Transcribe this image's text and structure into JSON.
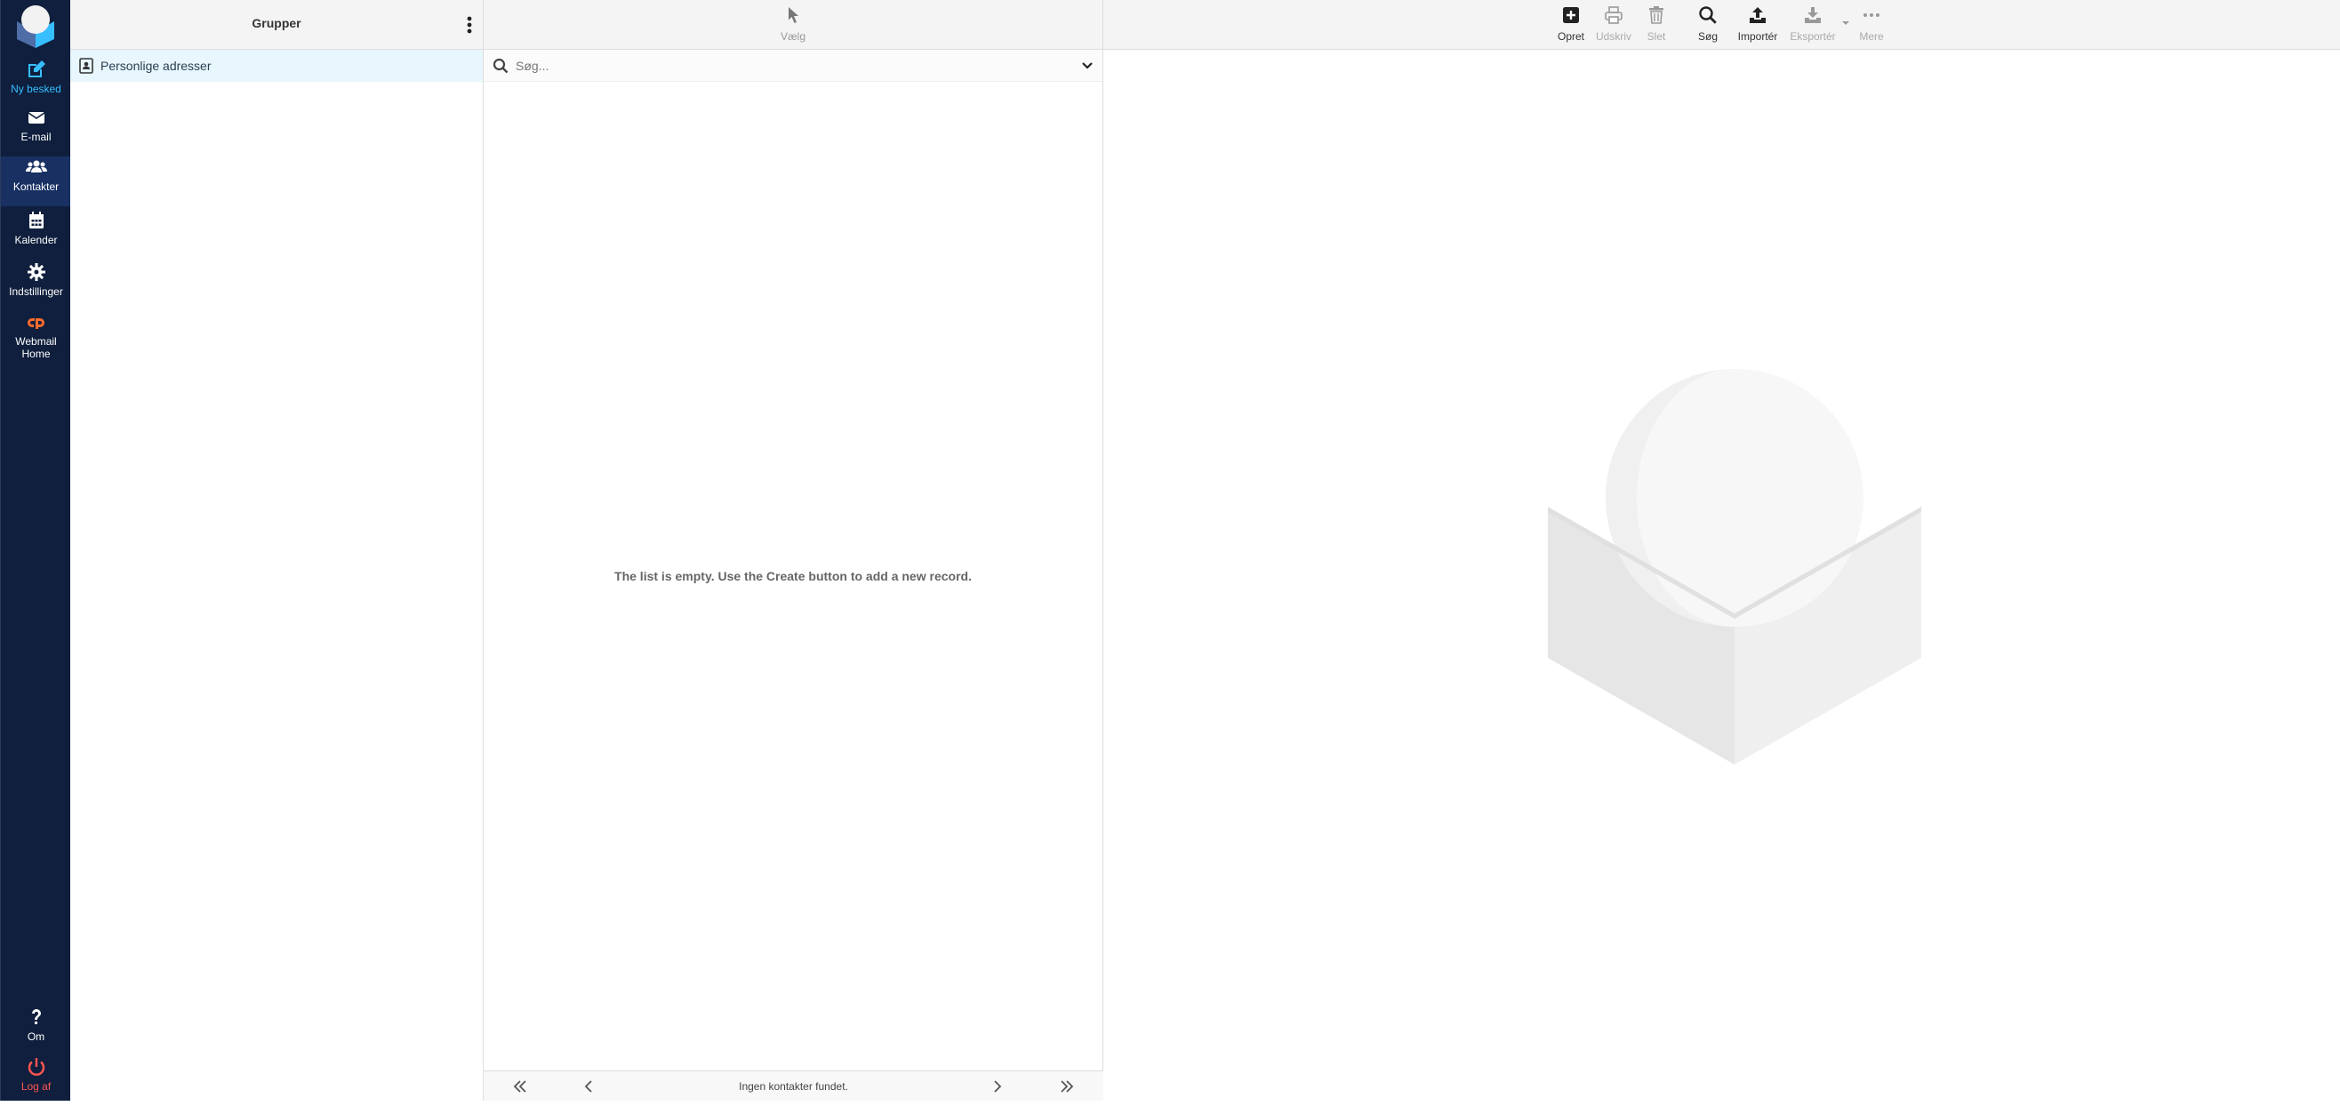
{
  "nav": {
    "compose": "Ny besked",
    "mail": "E-mail",
    "contacts": "Kontakter",
    "calendar": "Kalender",
    "settings": "Indstillinger",
    "webmail_home_1": "Webmail",
    "webmail_home_2": "Home",
    "about": "Om",
    "logout": "Log af"
  },
  "groups": {
    "title": "Grupper",
    "items": [
      {
        "label": "Personlige adresser"
      }
    ]
  },
  "list": {
    "select_label": "Vælg",
    "search_placeholder": "Søg...",
    "empty_message": "The list is empty. Use the Create button to add a new record.",
    "footer_text": "Ingen kontakter fundet."
  },
  "toolbar": {
    "create": "Opret",
    "print": "Udskriv",
    "delete": "Slet",
    "search": "Søg",
    "import": "Importér",
    "export": "Eksportér",
    "more": "Mere"
  },
  "colors": {
    "nav_bg": "#0f1f3d",
    "nav_active": "#183062",
    "compose_accent": "#37beff",
    "logout_accent": "#ff5552",
    "selected_group_bg": "#e8f6fd"
  }
}
